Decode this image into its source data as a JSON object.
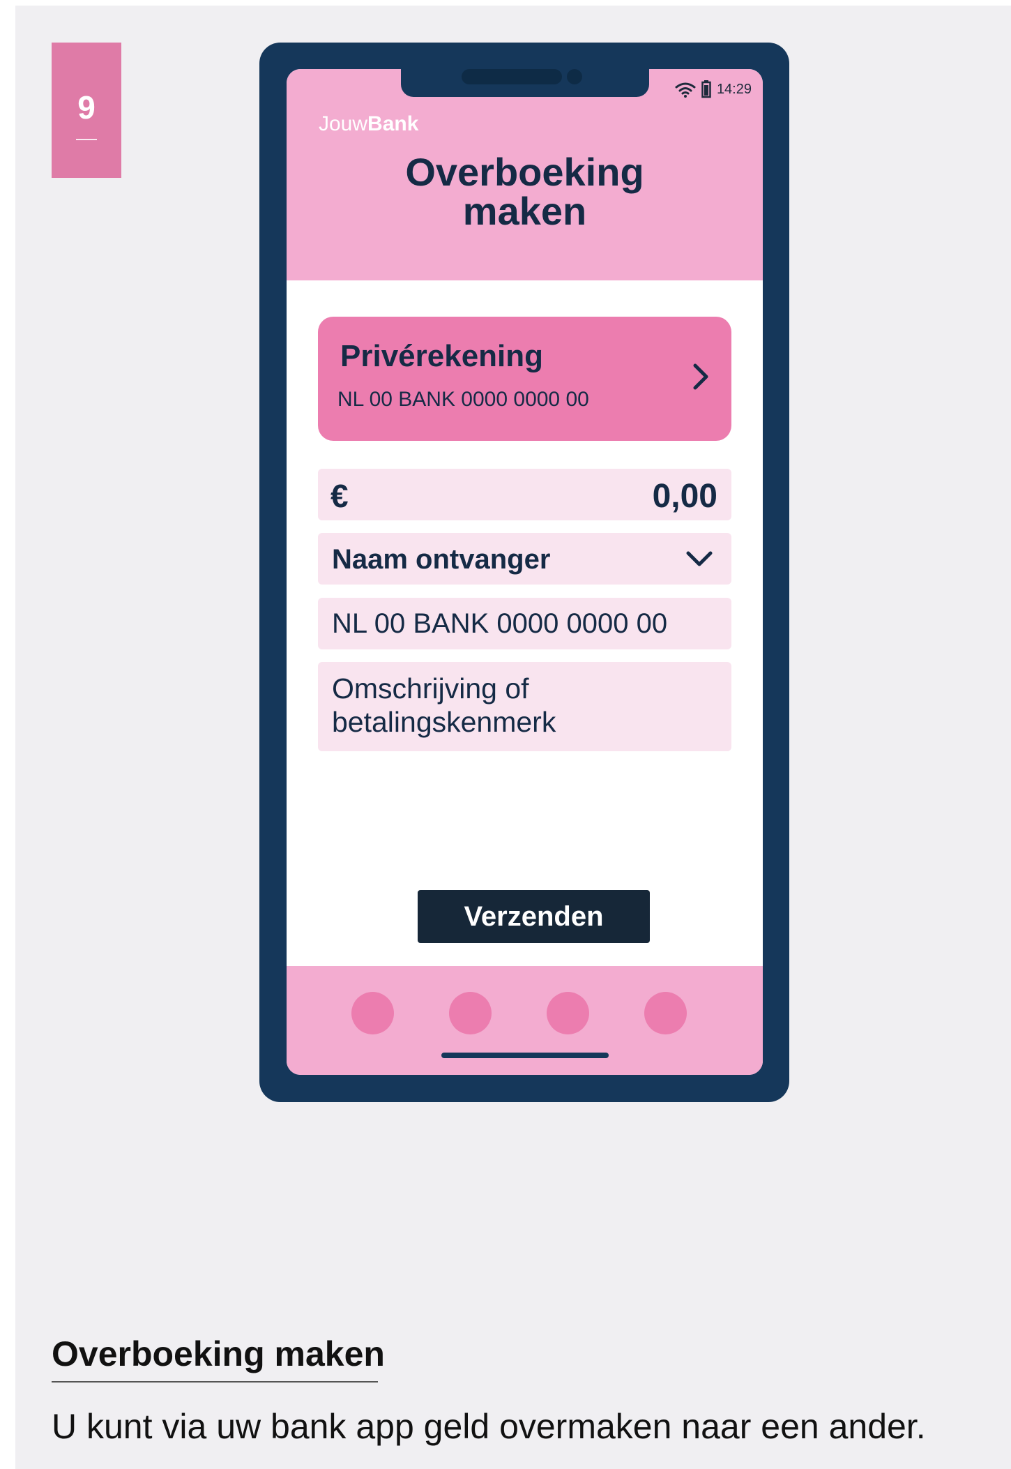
{
  "step": {
    "number": "9"
  },
  "phone": {
    "status": {
      "time": "14:29",
      "wifi_icon": "wifi-icon",
      "battery_icon": "battery-icon"
    },
    "brand": {
      "part1": "Jouw",
      "part2": "Bank"
    },
    "screen_title_line1": "Overboeking",
    "screen_title_line2": "maken",
    "account": {
      "name": "Privérekening",
      "iban": "NL 00 BANK 0000 0000 00",
      "icon": "chevron-right-icon"
    },
    "form": {
      "currency": "€",
      "amount": "0,00",
      "recipient_label": "Naam ontvanger",
      "recipient_icon": "chevron-down-icon",
      "iban_placeholder": "NL 00 BANK 0000 0000 00",
      "description_placeholder": "Omschrijving of betalingskenmerk"
    },
    "send_label": "Verzenden",
    "tabbar_dots": 4
  },
  "caption": {
    "title": "Overboeking maken",
    "text": "U kunt via uw bank app geld overmaken naar een ander."
  },
  "colors": {
    "background": "#f0eff2",
    "accent_pink": "#ec7daf",
    "light_pink": "#f3acd0",
    "field_pink": "#f9e4ef",
    "phone_frame": "#15375a",
    "button_dark": "#162738"
  }
}
